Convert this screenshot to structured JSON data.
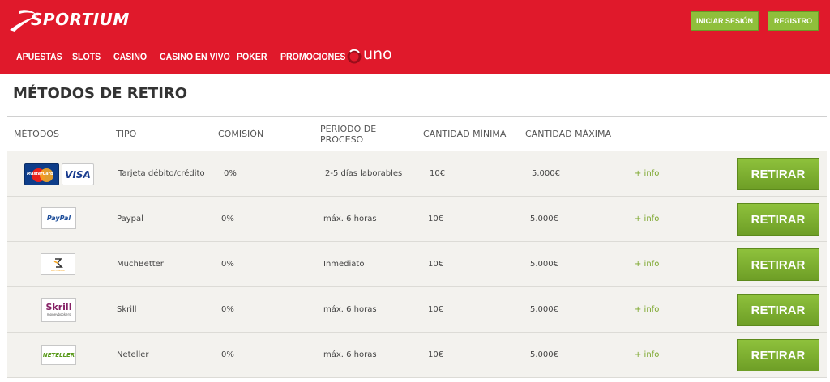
{
  "header": {
    "brand": "SPORTIUM",
    "login_label": "INICIAR SESIÓN",
    "register_label": "REGISTRO",
    "nav": [
      "APUESTAS",
      "SLOTS",
      "CASINO",
      "CASINO EN VIVO",
      "POKER",
      "PROMOCIONES"
    ],
    "uno_label": "UNO",
    "brand_color": "#e0192b"
  },
  "page": {
    "title": "MÉTODOS DE RETIRO"
  },
  "table": {
    "headers": {
      "method": "MÉTODOS",
      "type": "TIPO",
      "fee": "COMISIÓN",
      "period_1": "PERIODO DE",
      "period_2": "PROCESO",
      "min": "CANTIDAD MÍNIMA",
      "max": "CANTIDAD MÁXIMA"
    },
    "rows": [
      {
        "logo": "mastercard-visa",
        "logo_texts": [
          "MasterCard",
          "VISA"
        ],
        "type": "Tarjeta débito/crédito",
        "fee": "0%",
        "period": "2-5 días laborables",
        "min": "10€",
        "max": "5.000€",
        "info": "+ info",
        "action": "RETIRAR"
      },
      {
        "logo": "paypal",
        "logo_texts": [
          "PayPal"
        ],
        "type": "Paypal",
        "fee": "0%",
        "period": "máx. 6 horas",
        "min": "10€",
        "max": "5.000€",
        "info": "+ info",
        "action": "RETIRAR"
      },
      {
        "logo": "muchbetter",
        "logo_texts": [
          "MuchBetter"
        ],
        "type": "MuchBetter",
        "fee": "0%",
        "period": "Inmediato",
        "min": "10€",
        "max": "5.000€",
        "info": "+ info",
        "action": "RETIRAR"
      },
      {
        "logo": "skrill",
        "logo_texts": [
          "Skrill",
          "moneybookers"
        ],
        "type": "Skrill",
        "fee": "0%",
        "period": "máx. 6 horas",
        "min": "10€",
        "max": "5.000€",
        "info": "+ info",
        "action": "RETIRAR"
      },
      {
        "logo": "neteller",
        "logo_texts": [
          "NETELLER"
        ],
        "type": "Neteller",
        "fee": "0%",
        "period": "máx. 6 horas",
        "min": "10€",
        "max": "5.000€",
        "info": "+ info",
        "action": "RETIRAR"
      }
    ]
  },
  "colors": {
    "accent_green": "#8fbf3b",
    "info_green": "#7aa62a",
    "row_bg": "#f3f2ee"
  }
}
